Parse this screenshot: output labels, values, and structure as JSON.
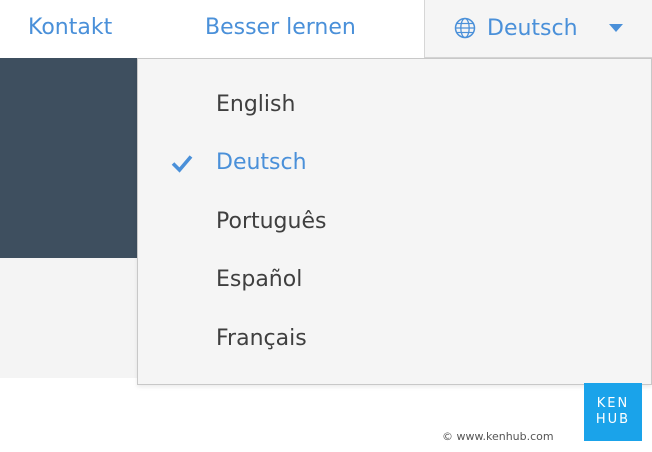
{
  "nav": {
    "links": [
      {
        "label": "Kontakt"
      },
      {
        "label": "Besser lernen"
      }
    ]
  },
  "language_selector": {
    "current": "Deutsch",
    "icon": "globe-icon",
    "caret_icon": "caret-down-icon"
  },
  "dropdown": {
    "options": [
      {
        "label": "English",
        "selected": false
      },
      {
        "label": "Deutsch",
        "selected": true
      },
      {
        "label": "Português",
        "selected": false
      },
      {
        "label": "Español",
        "selected": false
      },
      {
        "label": "Français",
        "selected": false
      }
    ]
  },
  "logo": {
    "line1": "KEN",
    "line2": "HUB"
  },
  "footer": {
    "copyright": "© www.kenhub.com"
  },
  "colors": {
    "accent": "#4a90d9",
    "dark_band": "#3e4f5f",
    "logo_bg": "#1aa3ea"
  }
}
